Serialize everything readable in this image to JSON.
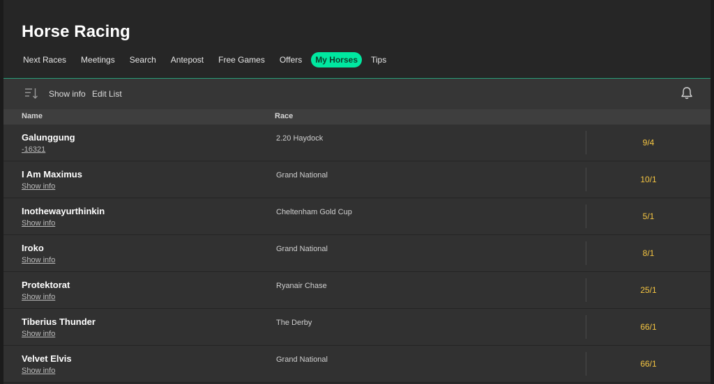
{
  "header": {
    "title": "Horse Racing",
    "tabs": [
      {
        "label": "Next Races"
      },
      {
        "label": "Meetings"
      },
      {
        "label": "Search"
      },
      {
        "label": "Antepost"
      },
      {
        "label": "Free Games"
      },
      {
        "label": "Offers"
      },
      {
        "label": "My Horses"
      },
      {
        "label": "Tips"
      }
    ],
    "active_tab": "My Horses"
  },
  "toolbar": {
    "sort_icon": "sort-descending-icon",
    "show_info_label": "Show info",
    "edit_list_label": "Edit List",
    "bell_icon": "bell-icon"
  },
  "table": {
    "columns": {
      "name": "Name",
      "race": "Race"
    },
    "rows": [
      {
        "name": "Galunggung",
        "sub": "-16321",
        "race": "2.20 Haydock",
        "odds": "9/4"
      },
      {
        "name": "I Am Maximus",
        "sub": "Show info",
        "race": "Grand National",
        "odds": "10/1"
      },
      {
        "name": "Inothewayurthinkin",
        "sub": "Show info",
        "race": "Cheltenham Gold Cup",
        "odds": "5/1"
      },
      {
        "name": "Iroko",
        "sub": "Show info",
        "race": "Grand National",
        "odds": "8/1"
      },
      {
        "name": "Protektorat",
        "sub": "Show info",
        "race": "Ryanair Chase",
        "odds": "25/1"
      },
      {
        "name": "Tiberius Thunder",
        "sub": "Show info",
        "race": "The Derby",
        "odds": "66/1"
      },
      {
        "name": "Velvet Elvis",
        "sub": "Show info",
        "race": "Grand National",
        "odds": "66/1"
      }
    ]
  },
  "colors": {
    "accent": "#00e8a0",
    "odds": "#f6c642",
    "background": "#2a2a2a"
  }
}
